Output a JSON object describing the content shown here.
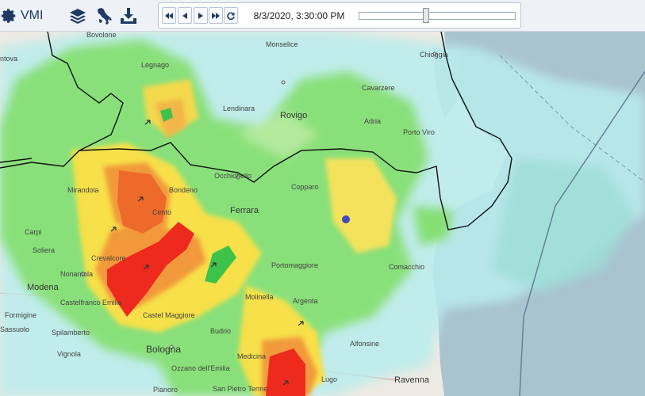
{
  "app": {
    "title": "VMI"
  },
  "toolbar": {
    "icons": [
      "gear-icon",
      "layers-icon",
      "italy-map-icon",
      "download-icon"
    ]
  },
  "playback": {
    "controls": [
      "skip-back-icon",
      "step-back-icon",
      "play-icon",
      "skip-forward-icon",
      "refresh-icon"
    ],
    "datetime": "8/3/2020, 3:30:00 PM",
    "slider_position": 0.43
  },
  "map": {
    "places": {
      "bovolone": "Bovolone",
      "legnago": "Legnago",
      "monselice": "Monselice",
      "chioggia": "Chioggia",
      "mantova": "ntova",
      "cavarzere": "Cavarzere",
      "lendinara": "Lendinara",
      "rovigo": "Rovigo",
      "adria": "Adria",
      "porto_viro": "Porto Viro",
      "occhiobello": "Occhiobello",
      "copparo": "Copparo",
      "mirandola": "Mirandola",
      "bondeno": "Bondeno",
      "ferrara": "Ferrara",
      "cento": "Cento",
      "carpi": "Carpi",
      "soliera": "Soliera",
      "crevalcore": "Crevalcore",
      "nonantola": "Nonantola",
      "portomaggiore": "Portomaggiore",
      "comacchio": "Comacchio",
      "modena": "Modena",
      "castelfranco": "Castelfranco Emilia",
      "molinella": "Molinella",
      "argenta": "Argenta",
      "formigine": "Formigine",
      "castel_maggiore": "Castel Maggiore",
      "sassuolo": "Sassuolo",
      "spilamberto": "Spilamberto",
      "budrio": "Budrio",
      "alfonsine": "Alfonsine",
      "bologna": "Bologna",
      "vignola": "Vignola",
      "medicina": "Medicina",
      "ozzano": "Ozzano dell'Emilia",
      "lugo": "Lugo",
      "ravenna": "Ravenna",
      "pianoro": "Pianoro",
      "san_pietro": "San Pietro Terme"
    },
    "colors": {
      "sea": "#a9c3cf",
      "land": "#eceae3",
      "rain_light": "#b9ecec",
      "rain_mid": "#86df74",
      "rain_heavy": "#f7e04a",
      "rain_very_heavy": "#f29a3a",
      "rain_extreme": "#ee2a1f",
      "border": "#111111",
      "accent": "#1f3a64"
    }
  }
}
